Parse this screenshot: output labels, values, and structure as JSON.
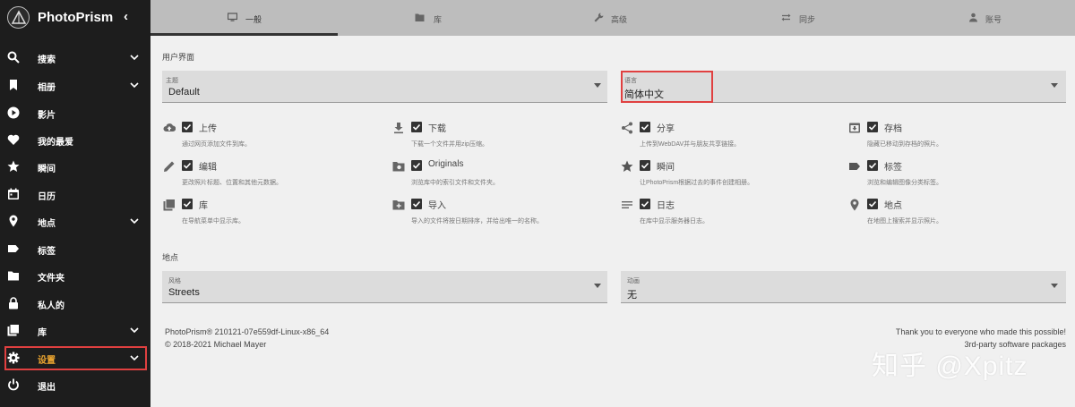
{
  "app": {
    "title": "PhotoPrism",
    "collapse_glyph": "‹"
  },
  "sidebar": {
    "items": [
      {
        "label": "搜索",
        "icon": "search-icon",
        "has_chevron": true
      },
      {
        "label": "相册",
        "icon": "bookmark-icon",
        "has_chevron": true
      },
      {
        "label": "影片",
        "icon": "play-circle-icon",
        "has_chevron": false
      },
      {
        "label": "我的最爱",
        "icon": "heart-icon",
        "has_chevron": false
      },
      {
        "label": "瞬间",
        "icon": "star-icon",
        "has_chevron": false
      },
      {
        "label": "日历",
        "icon": "calendar-icon",
        "has_chevron": false
      },
      {
        "label": "地点",
        "icon": "location-pin-icon",
        "has_chevron": true
      },
      {
        "label": "标签",
        "icon": "tag-icon",
        "has_chevron": false
      },
      {
        "label": "文件夹",
        "icon": "folder-icon",
        "has_chevron": false
      },
      {
        "label": "私人的",
        "icon": "lock-icon",
        "has_chevron": false
      },
      {
        "label": "库",
        "icon": "library-icon",
        "has_chevron": true
      },
      {
        "label": "设置",
        "icon": "gear-icon",
        "has_chevron": true,
        "active": true
      },
      {
        "label": "退出",
        "icon": "power-icon",
        "has_chevron": false
      }
    ]
  },
  "tabs": [
    {
      "label": "一般",
      "icon": "monitor-icon",
      "active": true
    },
    {
      "label": "库",
      "icon": "folder-image-icon"
    },
    {
      "label": "高级",
      "icon": "wrench-icon"
    },
    {
      "label": "同步",
      "icon": "sync-icon"
    },
    {
      "label": "账号",
      "icon": "person-icon"
    }
  ],
  "ui_section": {
    "title": "用户界面",
    "theme": {
      "label": "主题",
      "value": "Default"
    },
    "language": {
      "label": "语言",
      "value": "简体中文"
    }
  },
  "features": [
    {
      "name": "上传",
      "desc": "通过网页添加文件到库。",
      "icon": "cloud-upload-icon"
    },
    {
      "name": "下载",
      "desc": "下载一个文件并用zip压缩。",
      "icon": "download-icon"
    },
    {
      "name": "分享",
      "desc": "上传到WebDAV并与朋友共享链接。",
      "icon": "share-icon"
    },
    {
      "name": "存档",
      "desc": "隐藏已移动到存档的照片。",
      "icon": "archive-icon"
    },
    {
      "name": "编辑",
      "desc": "更改照片标题、位置和其他元数据。",
      "icon": "pencil-icon"
    },
    {
      "name": "Originals",
      "desc": "浏览库中的索引文件和文件夹。",
      "icon": "folder-camera-icon"
    },
    {
      "name": "瞬间",
      "desc": "让PhotoPrism根据过去的事件创建相册。",
      "icon": "star-icon"
    },
    {
      "name": "标签",
      "desc": "浏览和编辑图像分类标签。",
      "icon": "label-icon"
    },
    {
      "name": "库",
      "desc": "在导航菜单中显示库。",
      "icon": "library-icon"
    },
    {
      "name": "导入",
      "desc": "导入的文件将按日期排序，并给出唯一的名称。",
      "icon": "import-icon"
    },
    {
      "name": "日志",
      "desc": "在库中显示服务器日志。",
      "icon": "log-lines-icon"
    },
    {
      "name": "地点",
      "desc": "在地图上搜索并显示照片。",
      "icon": "location-pin-icon"
    }
  ],
  "places_section": {
    "title": "地点",
    "style": {
      "label": "风格",
      "value": "Streets"
    },
    "animation": {
      "label": "动画",
      "value": "无"
    }
  },
  "footer": {
    "version": "PhotoPrism® 210121-07e559df-Linux-x86_64",
    "copyright": "© 2018-2021 Michael Mayer",
    "thanks": "Thank you to everyone who made this possible!",
    "third_party": "3rd-party software packages"
  },
  "watermark": "知乎 @Xpitz",
  "colors": {
    "sidebar_bg": "#1d1d1d",
    "active_nav": "#f0a830",
    "highlight": "#e04040",
    "tabbar_bg": "#bdbdbd"
  }
}
